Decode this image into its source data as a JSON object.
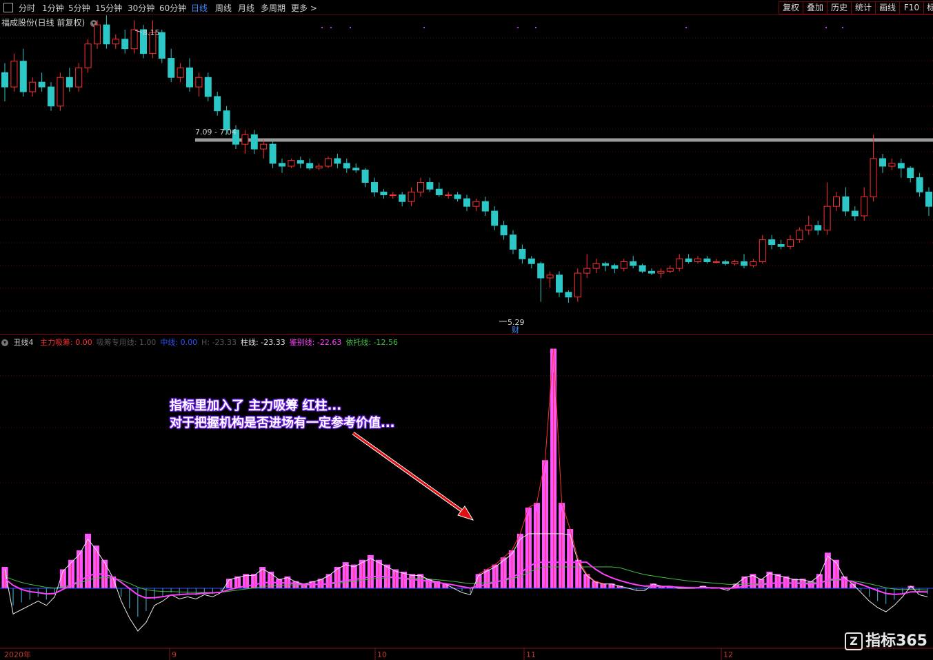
{
  "toolbar": {
    "periods": [
      "分时",
      "1分钟",
      "5分钟",
      "15分钟",
      "30分钟",
      "60分钟",
      "日线",
      "周线",
      "月线",
      "多周期",
      "更多 >"
    ],
    "active": "日线",
    "right_buttons": [
      "复权",
      "叠加",
      "历史",
      "统计",
      "画线",
      "F10",
      "标"
    ]
  },
  "main_legend": {
    "title": "福成股份(日线 前复权)"
  },
  "price_labels": {
    "high": "8.15",
    "range": "7.09 - 7.04",
    "low": "5.29",
    "cai": "财"
  },
  "indicator_legend": {
    "name": "丑线4",
    "items": [
      {
        "text": "主力吸筹: 0.00",
        "color": "#ff3030"
      },
      {
        "text": "吸筹专用线: 1.00",
        "color": "#555555"
      },
      {
        "text": "中线: 0.00",
        "color": "#3050ff"
      },
      {
        "text": "H: -23.33",
        "color": "#555555"
      },
      {
        "text": "柱线: -23.33",
        "color": "#e0e0e0"
      },
      {
        "text": "鉴别线: -22.63",
        "color": "#ff40ff"
      },
      {
        "text": "依托线: -12.56",
        "color": "#40c040"
      }
    ]
  },
  "annotation": {
    "line1": "指标里加入了 主力吸筹 红柱...",
    "line2": "对于把握机构是否进场有一定参考价值..."
  },
  "x_labels": [
    "2020年",
    "9",
    "10",
    "11",
    "12"
  ],
  "logo": {
    "mark": "Z",
    "text": "指标365"
  },
  "colors": {
    "up": "#ff3030",
    "down": "#2cc7c7",
    "magenta_bar": "#ff55ff",
    "grid": "#5a0e0e"
  },
  "chart_data": {
    "type": "candlestick",
    "price_candles": [
      [
        7.7,
        7.55,
        7.8,
        7.4
      ],
      [
        7.55,
        7.82,
        7.9,
        7.5
      ],
      [
        7.82,
        7.5,
        7.95,
        7.45
      ],
      [
        7.5,
        7.6,
        7.65,
        7.45
      ],
      [
        7.6,
        7.55,
        7.7,
        7.5
      ],
      [
        7.55,
        7.35,
        7.6,
        7.3
      ],
      [
        7.35,
        7.65,
        7.7,
        7.3
      ],
      [
        7.65,
        7.55,
        7.75,
        7.5
      ],
      [
        7.55,
        7.75,
        7.8,
        7.5
      ],
      [
        7.75,
        8.0,
        8.05,
        7.7
      ],
      [
        8.0,
        8.2,
        8.25,
        7.95
      ],
      [
        8.2,
        8.0,
        8.3,
        7.95
      ],
      [
        8.0,
        8.05,
        8.1,
        7.95
      ],
      [
        8.05,
        7.95,
        8.15,
        7.9
      ],
      [
        7.95,
        8.15,
        8.25,
        7.9
      ],
      [
        8.15,
        7.9,
        8.2,
        7.85
      ],
      [
        7.9,
        8.12,
        8.25,
        7.85
      ],
      [
        8.12,
        7.85,
        8.15,
        7.8
      ],
      [
        7.85,
        7.65,
        7.95,
        7.6
      ],
      [
        7.65,
        7.75,
        7.8,
        7.6
      ],
      [
        7.75,
        7.55,
        7.85,
        7.5
      ],
      [
        7.55,
        7.65,
        7.7,
        7.45
      ],
      [
        7.65,
        7.45,
        7.7,
        7.4
      ],
      [
        7.45,
        7.3,
        7.5,
        7.25
      ],
      [
        7.3,
        7.1,
        7.35,
        7.05
      ],
      [
        7.1,
        6.95,
        7.15,
        6.9
      ],
      [
        6.95,
        7.05,
        7.1,
        6.85
      ],
      [
        7.05,
        6.9,
        7.1,
        6.85
      ],
      [
        6.9,
        6.95,
        7.0,
        6.8
      ],
      [
        6.95,
        6.75,
        7.0,
        6.7
      ],
      [
        6.75,
        6.72,
        6.8,
        6.65
      ],
      [
        6.72,
        6.78,
        6.8,
        6.7
      ],
      [
        6.78,
        6.75,
        6.82,
        6.7
      ],
      [
        6.75,
        6.7,
        6.8,
        6.68
      ],
      [
        6.7,
        6.72,
        6.75,
        6.68
      ],
      [
        6.72,
        6.8,
        6.82,
        6.7
      ],
      [
        6.8,
        6.75,
        6.85,
        6.7
      ],
      [
        6.75,
        6.7,
        6.8,
        6.65
      ],
      [
        6.7,
        6.68,
        6.75,
        6.65
      ],
      [
        6.68,
        6.55,
        6.7,
        6.5
      ],
      [
        6.55,
        6.45,
        6.6,
        6.4
      ],
      [
        6.45,
        6.42,
        6.48,
        6.38
      ],
      [
        6.42,
        6.42,
        6.45,
        6.38
      ],
      [
        6.42,
        6.35,
        6.45,
        6.3
      ],
      [
        6.35,
        6.45,
        6.5,
        6.3
      ],
      [
        6.45,
        6.55,
        6.6,
        6.4
      ],
      [
        6.55,
        6.48,
        6.6,
        6.45
      ],
      [
        6.48,
        6.42,
        6.55,
        6.4
      ],
      [
        6.42,
        6.42,
        6.45,
        6.38
      ],
      [
        6.42,
        6.38,
        6.45,
        6.35
      ],
      [
        6.38,
        6.3,
        6.42,
        6.25
      ],
      [
        6.3,
        6.35,
        6.38,
        6.25
      ],
      [
        6.35,
        6.25,
        6.4,
        6.2
      ],
      [
        6.25,
        6.1,
        6.3,
        6.05
      ],
      [
        6.1,
        6.0,
        6.15,
        5.95
      ],
      [
        6.0,
        5.85,
        6.05,
        5.8
      ],
      [
        5.85,
        5.75,
        5.9,
        5.7
      ],
      [
        5.75,
        5.7,
        5.78,
        5.65
      ],
      [
        5.7,
        5.55,
        5.72,
        5.3
      ],
      [
        5.55,
        5.58,
        5.62,
        5.45
      ],
      [
        5.58,
        5.4,
        5.62,
        5.35
      ],
      [
        5.4,
        5.35,
        5.42,
        5.29
      ],
      [
        5.35,
        5.6,
        5.65,
        5.3
      ],
      [
        5.6,
        5.65,
        5.8,
        5.55
      ],
      [
        5.65,
        5.7,
        5.75,
        5.6
      ],
      [
        5.7,
        5.68,
        5.72,
        5.62
      ],
      [
        5.68,
        5.65,
        5.7,
        5.6
      ],
      [
        5.65,
        5.72,
        5.75,
        5.62
      ],
      [
        5.72,
        5.68,
        5.78,
        5.65
      ],
      [
        5.68,
        5.62,
        5.7,
        5.6
      ],
      [
        5.62,
        5.6,
        5.65,
        5.58
      ],
      [
        5.6,
        5.62,
        5.65,
        5.55
      ],
      [
        5.62,
        5.65,
        5.68,
        5.6
      ],
      [
        5.65,
        5.75,
        5.8,
        5.62
      ],
      [
        5.75,
        5.72,
        5.8,
        5.7
      ],
      [
        5.72,
        5.75,
        5.78,
        5.7
      ],
      [
        5.75,
        5.72,
        5.78,
        5.7
      ],
      [
        5.72,
        5.72,
        5.75,
        5.7
      ],
      [
        5.72,
        5.7,
        5.74,
        5.68
      ],
      [
        5.7,
        5.72,
        5.74,
        5.68
      ],
      [
        5.72,
        5.68,
        5.8,
        5.65
      ],
      [
        5.68,
        5.72,
        5.75,
        5.66
      ],
      [
        5.72,
        5.95,
        6.0,
        5.7
      ],
      [
        5.95,
        5.9,
        6.0,
        5.85
      ],
      [
        5.9,
        5.88,
        5.95,
        5.85
      ],
      [
        5.88,
        5.95,
        6.0,
        5.85
      ],
      [
        5.95,
        6.05,
        6.08,
        5.92
      ],
      [
        6.05,
        6.1,
        6.2,
        6.0
      ],
      [
        6.1,
        6.05,
        6.15,
        6.0
      ],
      [
        6.05,
        6.3,
        6.55,
        6.0
      ],
      [
        6.3,
        6.4,
        6.45,
        6.25
      ],
      [
        6.4,
        6.25,
        6.5,
        6.2
      ],
      [
        6.25,
        6.2,
        6.3,
        6.15
      ],
      [
        6.2,
        6.4,
        6.5,
        6.15
      ],
      [
        6.4,
        6.8,
        7.05,
        6.35
      ],
      [
        6.8,
        6.72,
        6.85,
        6.65
      ],
      [
        6.72,
        6.75,
        6.8,
        6.68
      ],
      [
        6.75,
        6.7,
        6.8,
        6.6
      ],
      [
        6.7,
        6.6,
        6.72,
        6.55
      ],
      [
        6.6,
        6.45,
        6.65,
        6.4
      ],
      [
        6.45,
        6.3,
        6.5,
        6.2
      ],
      [
        6.3,
        6.25,
        6.35,
        6.2
      ],
      [
        6.25,
        6.0,
        6.3,
        5.95
      ],
      [
        6.0,
        5.9,
        6.05,
        5.85
      ],
      [
        5.9,
        5.95,
        6.1,
        5.88
      ],
      [
        5.95,
        6.0,
        6.05,
        5.9
      ],
      [
        6.0,
        5.88,
        6.15,
        5.85
      ],
      [
        5.88,
        5.8,
        5.92,
        5.75
      ],
      [
        5.8,
        5.85,
        5.9,
        5.78
      ]
    ],
    "histogram": [
      0.9,
      -1.2,
      -1.0,
      -0.8,
      -0.6,
      -0.8,
      -0.4,
      0.8,
      1.2,
      1.6,
      2.3,
      1.8,
      1.2,
      0.5,
      -0.6,
      -1.4,
      -2.0,
      -1.6,
      -0.8,
      -0.6,
      -0.3,
      -0.5,
      -0.4,
      -0.5,
      -0.3,
      -0.4,
      -0.2,
      0.4,
      0.5,
      0.6,
      0.6,
      0.9,
      0.7,
      0.4,
      0.5,
      0.3,
      0.2,
      0.3,
      0.4,
      0.6,
      0.9,
      1.1,
      1.0,
      1.2,
      1.4,
      1.2,
      1.0,
      0.8,
      0.7,
      0.6,
      0.6,
      0.4,
      0.3,
      0.2,
      0.0,
      -0.2,
      -0.3,
      0.6,
      0.8,
      1.0,
      1.3,
      1.6,
      2.3,
      3.4,
      3.6,
      5.4,
      10.1,
      3.6,
      2.5,
      1.2,
      0.6,
      0.3,
      0.2,
      0.2,
      0.1,
      0.0,
      -0.1,
      -0.1,
      0.2,
      0.1,
      0.1,
      0.0,
      0.0,
      0.0,
      0.1,
      0.0,
      0.0,
      -0.1,
      0.2,
      0.5,
      0.6,
      0.4,
      0.7,
      0.6,
      0.5,
      0.4,
      0.4,
      0.3,
      0.6,
      1.5,
      1.2,
      0.5,
      0.2,
      -0.2,
      -0.6,
      -0.9,
      -1.1,
      -0.8,
      -0.4,
      0.1,
      -0.3,
      -0.4
    ]
  }
}
